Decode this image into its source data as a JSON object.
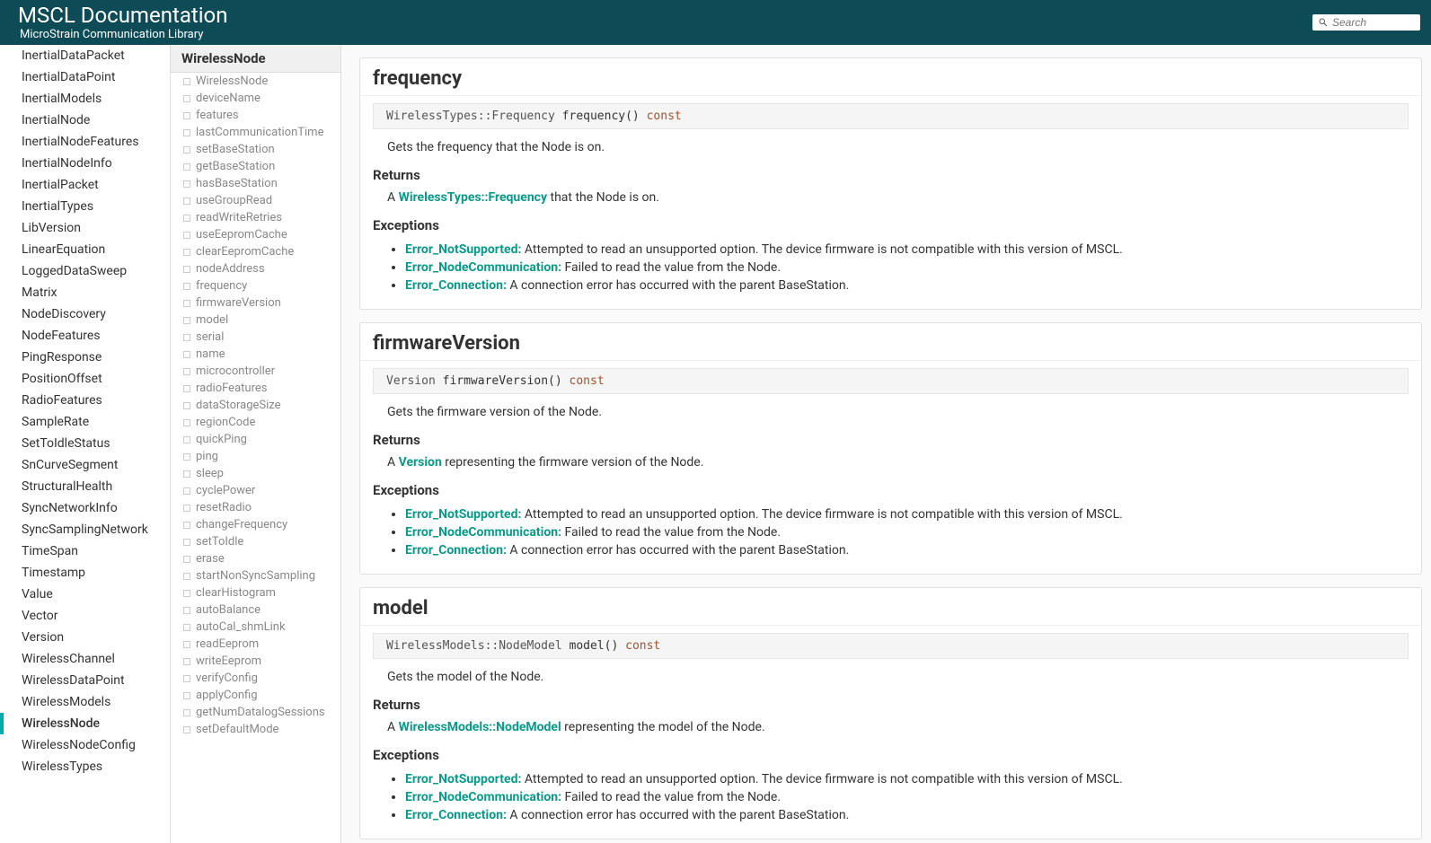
{
  "header": {
    "title": "MSCL Documentation",
    "subtitle": "MicroStrain Communication Library",
    "search_placeholder": "Search"
  },
  "nav1": {
    "items": [
      "InertialDataPacket",
      "InertialDataPoint",
      "InertialModels",
      "InertialNode",
      "InertialNodeFeatures",
      "InertialNodeInfo",
      "InertialPacket",
      "InertialTypes",
      "LibVersion",
      "LinearEquation",
      "LoggedDataSweep",
      "Matrix",
      "NodeDiscovery",
      "NodeFeatures",
      "PingResponse",
      "PositionOffset",
      "RadioFeatures",
      "SampleRate",
      "SetToIdleStatus",
      "SnCurveSegment",
      "StructuralHealth",
      "SyncNetworkInfo",
      "SyncSamplingNetwork",
      "TimeSpan",
      "Timestamp",
      "Value",
      "Vector",
      "Version",
      "WirelessChannel",
      "WirelessDataPoint",
      "WirelessModels",
      "WirelessNode",
      "WirelessNodeConfig",
      "WirelessTypes"
    ],
    "active": "WirelessNode"
  },
  "nav2": {
    "header": "WirelessNode",
    "items": [
      "WirelessNode",
      "deviceName",
      "features",
      "lastCommunicationTime",
      "setBaseStation",
      "getBaseStation",
      "hasBaseStation",
      "useGroupRead",
      "readWriteRetries",
      "useEepromCache",
      "clearEepromCache",
      "nodeAddress",
      "frequency",
      "firmwareVersion",
      "model",
      "serial",
      "name",
      "microcontroller",
      "radioFeatures",
      "dataStorageSize",
      "regionCode",
      "quickPing",
      "ping",
      "sleep",
      "cyclePower",
      "resetRadio",
      "changeFrequency",
      "setToIdle",
      "erase",
      "startNonSyncSampling",
      "clearHistogram",
      "autoBalance",
      "autoCal_shmLink",
      "readEeprom",
      "writeEeprom",
      "verifyConfig",
      "applyConfig",
      "getNumDatalogSessions",
      "setDefaultMode"
    ]
  },
  "sections": [
    {
      "title": "frequency",
      "code_type": "WirelessTypes::Frequency",
      "code_name": "frequency()",
      "code_kw": "const",
      "desc": "Gets the frequency that the Node is on.",
      "returns_prefix": "A ",
      "returns_link": "WirelessTypes::Frequency",
      "returns_suffix": " that the Node is on.",
      "exceptions": [
        {
          "err": "Error_NotSupported:",
          "txt": " Attempted to read an unsupported option. The device firmware is not compatible with this version of MSCL."
        },
        {
          "err": "Error_NodeCommunication:",
          "txt": " Failed to read the value from the Node."
        },
        {
          "err": "Error_Connection:",
          "txt": " A connection error has occurred with the parent BaseStation."
        }
      ]
    },
    {
      "title": "firmwareVersion",
      "code_type": "Version",
      "code_name": "firmwareVersion()",
      "code_kw": "const",
      "desc": "Gets the firmware version of the Node.",
      "returns_prefix": "A ",
      "returns_link": "Version",
      "returns_suffix": " representing the firmware version of the Node.",
      "exceptions": [
        {
          "err": "Error_NotSupported:",
          "txt": " Attempted to read an unsupported option. The device firmware is not compatible with this version of MSCL."
        },
        {
          "err": "Error_NodeCommunication:",
          "txt": " Failed to read the value from the Node."
        },
        {
          "err": "Error_Connection:",
          "txt": " A connection error has occurred with the parent BaseStation."
        }
      ]
    },
    {
      "title": "model",
      "code_type": "WirelessModels::NodeModel",
      "code_name": "model()",
      "code_kw": "const",
      "desc": "Gets the model of the Node.",
      "returns_prefix": "A ",
      "returns_link": "WirelessModels::NodeModel",
      "returns_suffix": " representing the model of the Node.",
      "exceptions": [
        {
          "err": "Error_NotSupported:",
          "txt": " Attempted to read an unsupported option. The device firmware is not compatible with this version of MSCL."
        },
        {
          "err": "Error_NodeCommunication:",
          "txt": " Failed to read the value from the Node."
        },
        {
          "err": "Error_Connection:",
          "txt": " A connection error has occurred with the parent BaseStation."
        }
      ]
    }
  ],
  "labels": {
    "returns": "Returns",
    "exceptions": "Exceptions"
  }
}
